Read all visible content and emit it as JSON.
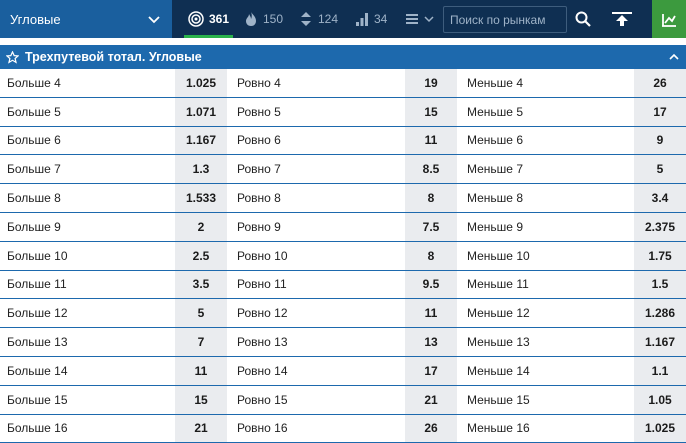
{
  "toolbar": {
    "market_select": "Угловые",
    "filters": [
      {
        "icon": "target-icon",
        "count": "361",
        "active": true
      },
      {
        "icon": "flame-icon",
        "count": "150",
        "active": false
      },
      {
        "icon": "up-down-arrows-icon",
        "count": "124",
        "active": false
      },
      {
        "icon": "ladder-icon",
        "count": "34",
        "active": false
      },
      {
        "icon": "list-icon",
        "count": "",
        "active": false
      }
    ],
    "search_placeholder": "Поиск по рынкам",
    "accent_color": "#2ab24b"
  },
  "section": {
    "title": "Трехпутевой тотал. Угловые"
  },
  "rows": [
    {
      "over": "Больше 4",
      "over_odd": "1.025",
      "eq": "Ровно 4",
      "eq_odd": "19",
      "under": "Меньше 4",
      "under_odd": "26"
    },
    {
      "over": "Больше 5",
      "over_odd": "1.071",
      "eq": "Ровно 5",
      "eq_odd": "15",
      "under": "Меньше 5",
      "under_odd": "17"
    },
    {
      "over": "Больше 6",
      "over_odd": "1.167",
      "eq": "Ровно 6",
      "eq_odd": "11",
      "under": "Меньше 6",
      "under_odd": "9"
    },
    {
      "over": "Больше 7",
      "over_odd": "1.3",
      "eq": "Ровно 7",
      "eq_odd": "8.5",
      "under": "Меньше 7",
      "under_odd": "5"
    },
    {
      "over": "Больше 8",
      "over_odd": "1.533",
      "eq": "Ровно 8",
      "eq_odd": "8",
      "under": "Меньше 8",
      "under_odd": "3.4"
    },
    {
      "over": "Больше 9",
      "over_odd": "2",
      "eq": "Ровно 9",
      "eq_odd": "7.5",
      "under": "Меньше 9",
      "under_odd": "2.375"
    },
    {
      "over": "Больше 10",
      "over_odd": "2.5",
      "eq": "Ровно 10",
      "eq_odd": "8",
      "under": "Меньше 10",
      "under_odd": "1.75"
    },
    {
      "over": "Больше 11",
      "over_odd": "3.5",
      "eq": "Ровно 11",
      "eq_odd": "9.5",
      "under": "Меньше 11",
      "under_odd": "1.5"
    },
    {
      "over": "Больше 12",
      "over_odd": "5",
      "eq": "Ровно 12",
      "eq_odd": "11",
      "under": "Меньше 12",
      "under_odd": "1.286"
    },
    {
      "over": "Больше 13",
      "over_odd": "7",
      "eq": "Ровно 13",
      "eq_odd": "13",
      "under": "Меньше 13",
      "under_odd": "1.167"
    },
    {
      "over": "Больше 14",
      "over_odd": "11",
      "eq": "Ровно 14",
      "eq_odd": "17",
      "under": "Меньше 14",
      "under_odd": "1.1"
    },
    {
      "over": "Больше 15",
      "over_odd": "15",
      "eq": "Ровно 15",
      "eq_odd": "21",
      "under": "Меньше 15",
      "under_odd": "1.05"
    },
    {
      "over": "Больше 16",
      "over_odd": "21",
      "eq": "Ровно 16",
      "eq_odd": "26",
      "under": "Меньше 16",
      "under_odd": "1.025"
    }
  ]
}
